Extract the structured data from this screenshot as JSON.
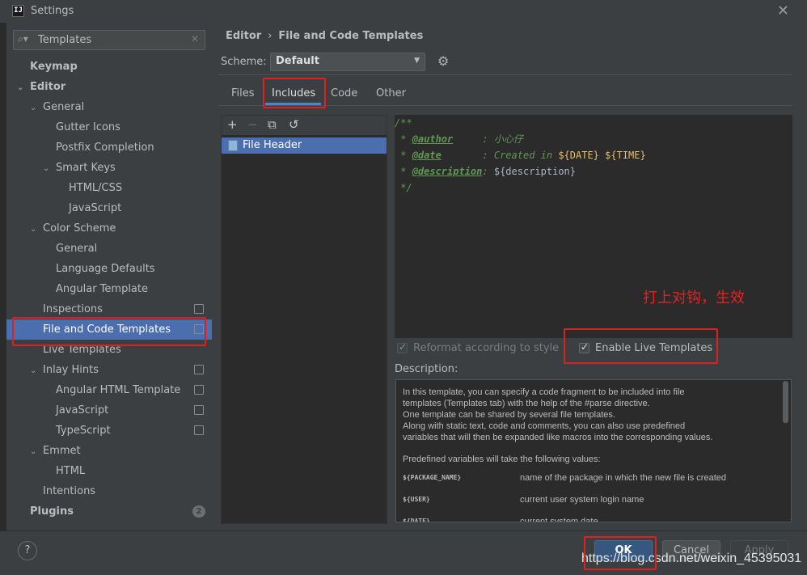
{
  "window": {
    "title": "Settings",
    "app_icon_text": "IJ"
  },
  "search": {
    "value": "Templates"
  },
  "sidebar": {
    "items": [
      {
        "label": "Keymap"
      },
      {
        "label": "Editor"
      },
      {
        "label": "General"
      },
      {
        "label": "Gutter Icons"
      },
      {
        "label": "Postfix Completion"
      },
      {
        "label": "Smart Keys"
      },
      {
        "label": "HTML/CSS"
      },
      {
        "label": "JavaScript"
      },
      {
        "label": "Color Scheme"
      },
      {
        "label": "General"
      },
      {
        "label": "Language Defaults"
      },
      {
        "label": "Angular Template"
      },
      {
        "label": "Inspections"
      },
      {
        "label": "File and Code Templates"
      },
      {
        "label": "Live Templates"
      },
      {
        "label": "Inlay Hints"
      },
      {
        "label": "Angular HTML Template"
      },
      {
        "label": "JavaScript"
      },
      {
        "label": "TypeScript"
      },
      {
        "label": "Emmet"
      },
      {
        "label": "HTML"
      },
      {
        "label": "Intentions"
      },
      {
        "label": "Plugins",
        "badge": "2"
      }
    ]
  },
  "breadcrumb": {
    "parent": "Editor",
    "separator": "›",
    "current": "File and Code Templates"
  },
  "scheme": {
    "label": "Scheme:",
    "value": "Default"
  },
  "tabs": [
    {
      "label": "Files"
    },
    {
      "label": "Includes"
    },
    {
      "label": "Code"
    },
    {
      "label": "Other"
    }
  ],
  "template_list": {
    "items": [
      {
        "label": "File Header"
      }
    ]
  },
  "editor": {
    "lines": [
      {
        "prefix": "/**"
      },
      {
        "prefix": " * ",
        "tag": "@author",
        "pad": "     : ",
        "value": "小心仔"
      },
      {
        "prefix": " * ",
        "tag": "@date",
        "pad": "       : ",
        "value": "Created in ",
        "v1": "${DATE}",
        "space": " ",
        "v2": "${TIME}"
      },
      {
        "prefix": " * ",
        "tag": "@description",
        "pad": ": ",
        "v1": "${description}"
      },
      {
        "prefix": " */"
      }
    ]
  },
  "options": {
    "reformat_label": "Reformat according to style",
    "live_templates_label": "Enable Live Templates"
  },
  "description": {
    "label": "Description:",
    "lines": [
      "In this template, you can specify a code fragment to be included into file",
      "templates (Templates tab) with the help of the #parse directive.",
      "One template can be shared by several file templates.",
      "Along with static text, code and comments, you can also use predefined",
      "variables that will then be expanded like macros into the corresponding values.",
      "Predefined variables will take the following values:"
    ],
    "variables": [
      {
        "name": "${PACKAGE_NAME}",
        "desc": "name of the package in which the new file is created"
      },
      {
        "name": "${USER}",
        "desc": "current user system login name"
      },
      {
        "name": "${DATE}",
        "desc": "current system date"
      }
    ]
  },
  "annotation": "打上对钩，生效",
  "buttons": {
    "help": "?",
    "ok": "OK",
    "cancel": "Cancel",
    "apply": "Apply"
  },
  "watermark": "https://blog.csdn.net/weixin_45395031",
  "colors": {
    "selection": "#4b6eaf",
    "highlight": "#e02020",
    "accent": "#4a88c7"
  }
}
